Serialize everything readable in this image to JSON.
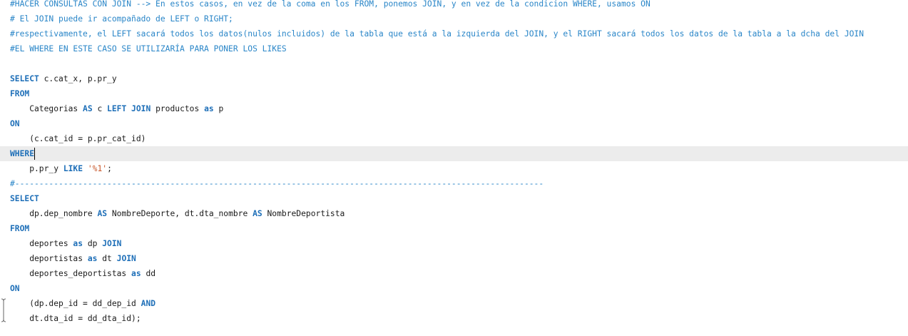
{
  "editor": {
    "lines": [
      "#HACER CONSULTAS CON JOIN --> En estos casos, en vez de la coma en los FROM, ponemos JOIN, y en vez de la condicion WHERE, usamos ON",
      "# El JOIN puede ir acompañado de LEFT o RIGHT;",
      "#respectivamente, el LEFT sacará todos los datos(nulos incluidos) de la tabla que está a la izquierda del JOIN, y el RIGHT sacará todos los datos de la tabla a la dcha del JOIN",
      "#EL WHERE EN ESTE CASO SE UTILIZARÍA PARA PONER LOS LIKES",
      "",
      "SELECT",
      " c.cat_x, p.pr_y",
      "FROM",
      "    Categorias ",
      "AS",
      " c ",
      "LEFT JOIN",
      " productos ",
      "as",
      " p",
      "ON",
      "    (c.cat_id = p.pr_cat_id)",
      "WHERE",
      "    p.pr_y ",
      "LIKE",
      " ",
      "'%1'",
      ";",
      "#-------------------------------------------------------------------------------------------------------------",
      "SELECT",
      "    dp.dep_nombre ",
      "AS",
      " NombreDeporte, dt.dta_nombre ",
      "AS",
      " NombreDeportista",
      "FROM",
      "    deportes ",
      "as",
      " dp ",
      "JOIN",
      "    deportistas ",
      "as",
      " dt ",
      "JOIN",
      "    deportes_deportistas ",
      "as",
      " dd",
      "ON",
      "    (dp.dep_id = dd_dep_id ",
      "AND",
      "    dt.dta_id = dd_dta_id);"
    ]
  },
  "colors": {
    "comment": "#2a86c8",
    "keyword": "#1e6fb8",
    "string": "#c9582b",
    "text": "#1a1a1a",
    "current_line": "#ececec"
  }
}
